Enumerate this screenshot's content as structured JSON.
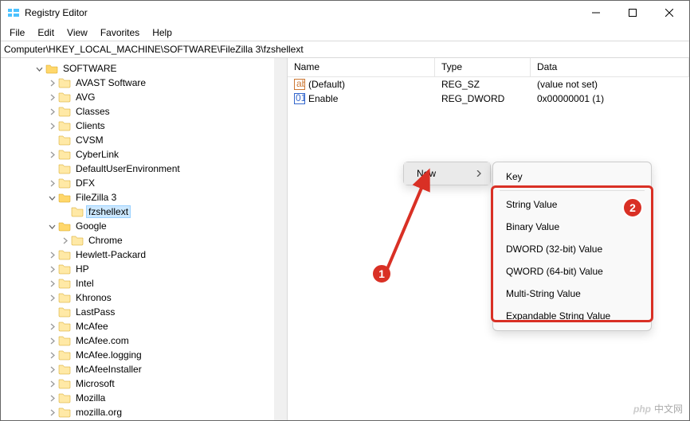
{
  "window": {
    "title": "Registry Editor"
  },
  "menu": {
    "file": "File",
    "edit": "Edit",
    "view": "View",
    "favorites": "Favorites",
    "help": "Help"
  },
  "address": {
    "path": "Computer\\HKEY_LOCAL_MACHINE\\SOFTWARE\\FileZilla 3\\fzshellext"
  },
  "tree": {
    "root": "SOFTWARE",
    "items": [
      {
        "label": "AVAST Software",
        "indent": 3,
        "exp": "closed"
      },
      {
        "label": "AVG",
        "indent": 3,
        "exp": "closed"
      },
      {
        "label": "Classes",
        "indent": 3,
        "exp": "closed"
      },
      {
        "label": "Clients",
        "indent": 3,
        "exp": "closed"
      },
      {
        "label": "CVSM",
        "indent": 3,
        "exp": "none"
      },
      {
        "label": "CyberLink",
        "indent": 3,
        "exp": "closed"
      },
      {
        "label": "DefaultUserEnvironment",
        "indent": 3,
        "exp": "none"
      },
      {
        "label": "DFX",
        "indent": 3,
        "exp": "closed"
      },
      {
        "label": "FileZilla 3",
        "indent": 3,
        "exp": "open"
      },
      {
        "label": "fzshellext",
        "indent": 4,
        "exp": "none",
        "selected": true
      },
      {
        "label": "Google",
        "indent": 3,
        "exp": "open"
      },
      {
        "label": "Chrome",
        "indent": 4,
        "exp": "closed"
      },
      {
        "label": "Hewlett-Packard",
        "indent": 3,
        "exp": "closed"
      },
      {
        "label": "HP",
        "indent": 3,
        "exp": "closed"
      },
      {
        "label": "Intel",
        "indent": 3,
        "exp": "closed"
      },
      {
        "label": "Khronos",
        "indent": 3,
        "exp": "closed"
      },
      {
        "label": "LastPass",
        "indent": 3,
        "exp": "none"
      },
      {
        "label": "McAfee",
        "indent": 3,
        "exp": "closed"
      },
      {
        "label": "McAfee.com",
        "indent": 3,
        "exp": "closed"
      },
      {
        "label": "McAfee.logging",
        "indent": 3,
        "exp": "closed"
      },
      {
        "label": "McAfeeInstaller",
        "indent": 3,
        "exp": "closed"
      },
      {
        "label": "Microsoft",
        "indent": 3,
        "exp": "closed"
      },
      {
        "label": "Mozilla",
        "indent": 3,
        "exp": "closed"
      },
      {
        "label": "mozilla.org",
        "indent": 3,
        "exp": "closed"
      }
    ]
  },
  "list": {
    "headers": {
      "name": "Name",
      "type": "Type",
      "data": "Data"
    },
    "rows": [
      {
        "name": "(Default)",
        "icon": "sz",
        "type": "REG_SZ",
        "data": "(value not set)"
      },
      {
        "name": "Enable",
        "icon": "dw",
        "type": "REG_DWORD",
        "data": "0x00000001 (1)"
      }
    ]
  },
  "context": {
    "new": "New",
    "sub": {
      "key": "Key",
      "string": "String Value",
      "binary": "Binary Value",
      "dword": "DWORD (32-bit) Value",
      "qword": "QWORD (64-bit) Value",
      "multi": "Multi-String Value",
      "expand": "Expandable String Value"
    }
  },
  "annotations": {
    "badge1": "1",
    "badge2": "2"
  },
  "watermark": {
    "text": "中文网",
    "logo": "php"
  }
}
